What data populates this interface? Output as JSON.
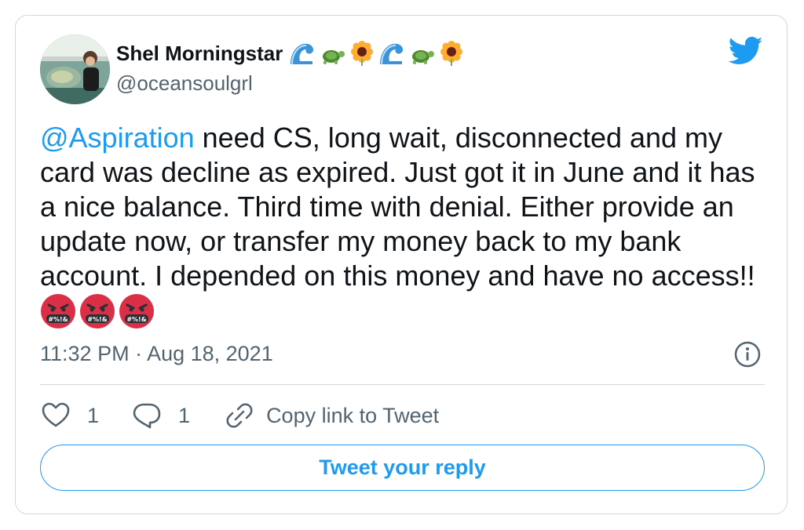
{
  "author": {
    "display_name": "Shel Morningstar",
    "name_emojis": [
      "wave-icon",
      "turtle-icon",
      "sunflower-icon",
      "wave-icon",
      "turtle-icon",
      "sunflower-icon"
    ],
    "handle": "@oceansoulgrl"
  },
  "tweet": {
    "mention": "@Aspiration",
    "body": " need CS, long wait, disconnected and my card was decline as expired. Just got it in June and it has a nice balance. Third time with denial. Either provide an update now, or transfer my money back to my bank account. I depended on this money and have no access!!",
    "trailing_emojis": [
      "angry-cursing-face-icon",
      "angry-cursing-face-icon",
      "angry-cursing-face-icon"
    ],
    "timestamp": "11:32 PM · Aug 18, 2021"
  },
  "actions": {
    "like_count": "1",
    "reply_count": "1",
    "copy_link_label": "Copy link to Tweet"
  },
  "reply_button": {
    "label": "Tweet your reply"
  },
  "colors": {
    "accent": "#1d9bf0",
    "text": "#0f1419",
    "secondary": "#536471",
    "border": "#cfd9de"
  }
}
